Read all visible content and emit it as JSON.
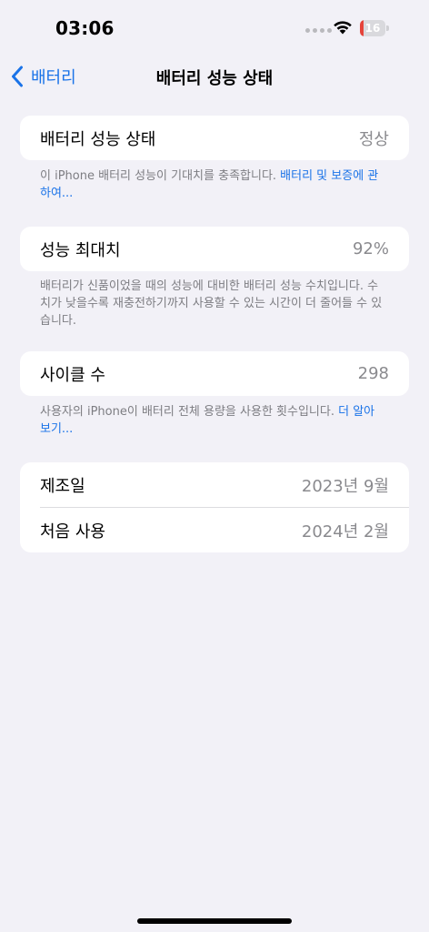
{
  "status_bar": {
    "time": "03:06",
    "battery_level": "16",
    "battery_fraction": 0.16,
    "battery_color": "#e5443b"
  },
  "nav": {
    "back_label": "배터리",
    "title": "배터리 성능 상태"
  },
  "sections": {
    "health": {
      "label": "배터리 성능 상태",
      "value": "정상",
      "footnote_text": "이 iPhone 배터리 성능이 기대치를 충족합니다. ",
      "footnote_link": "배터리 및 보증에 관하여..."
    },
    "max_capacity": {
      "label": "성능 최대치",
      "value": "92%",
      "footnote_text": "배터리가 신품이었을 때의 성능에 대비한 배터리 성능 수치입니다. 수치가 낮을수록 재충전하기까지 사용할 수 있는 시간이 더 줄어들 수 있습니다."
    },
    "cycle_count": {
      "label": "사이클 수",
      "value": "298",
      "footnote_text": "사용자의 iPhone이 배터리 전체 용량을 사용한 횟수입니다. ",
      "footnote_link": "더 알아보기..."
    },
    "dates": {
      "manufacture_label": "제조일",
      "manufacture_value": "2023년 9월",
      "first_use_label": "처음 사용",
      "first_use_value": "2024년 2월"
    }
  },
  "colors": {
    "accent": "#1a73e8",
    "background": "#f2f1f7",
    "secondary_text": "#8a8a8e"
  }
}
